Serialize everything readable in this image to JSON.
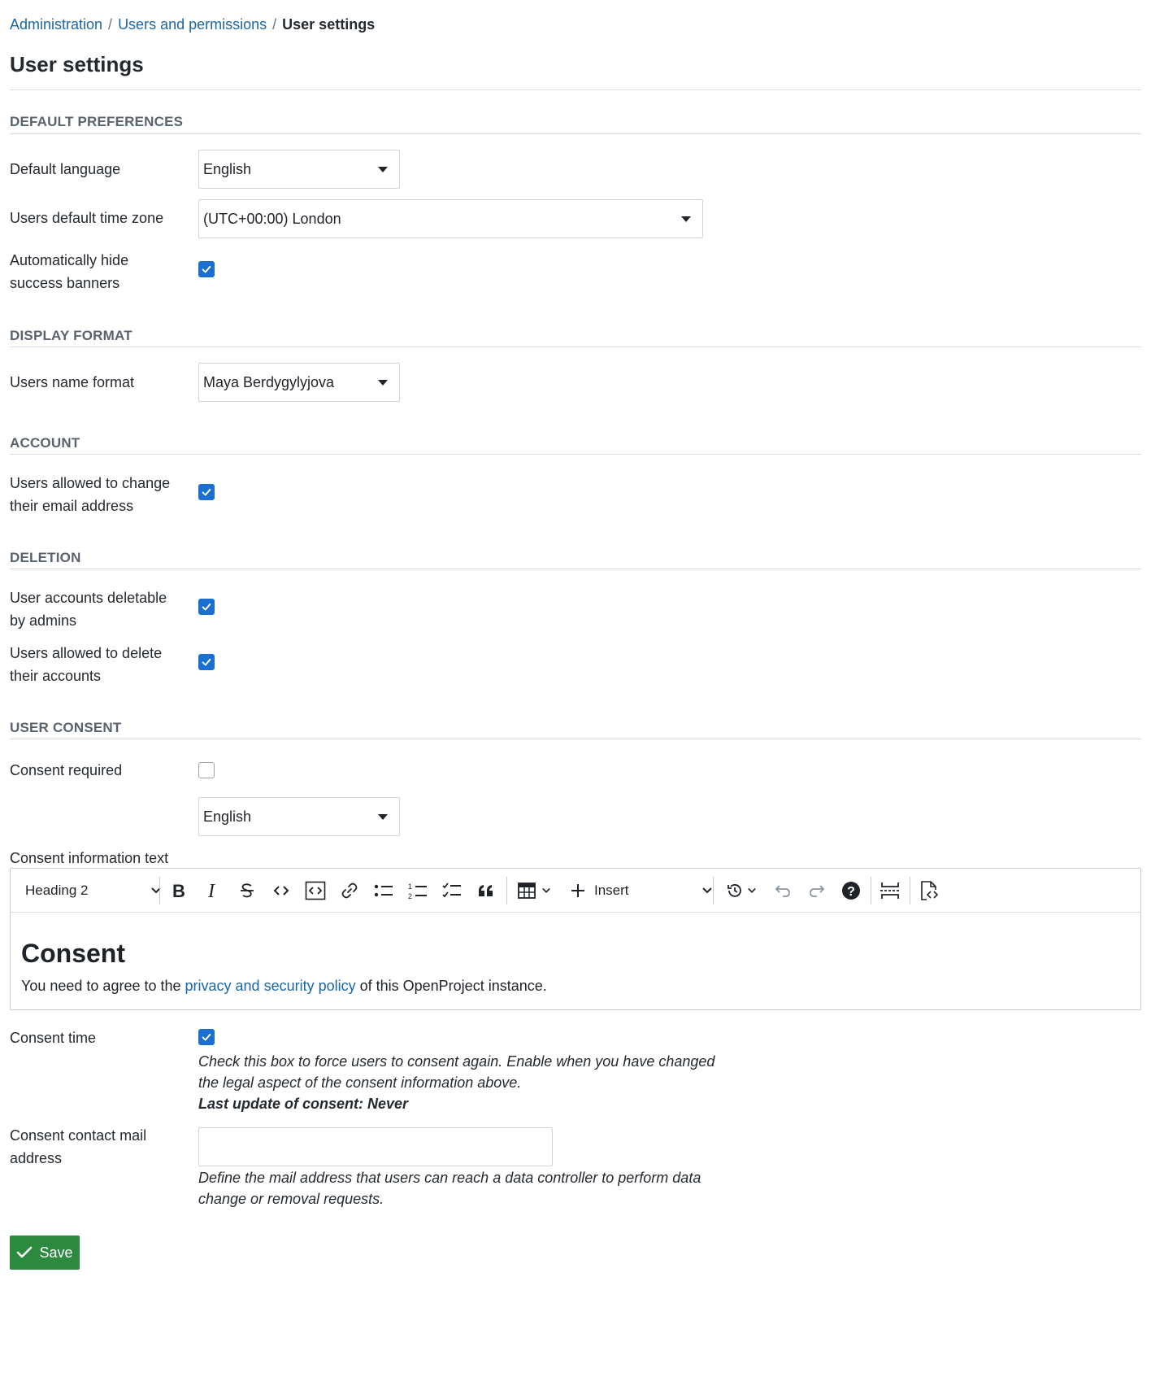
{
  "breadcrumb": {
    "items": [
      "Administration",
      "Users and permissions"
    ],
    "separator": "/",
    "current": "User settings"
  },
  "page_title": "User settings",
  "sections": {
    "default_preferences": {
      "title": "DEFAULT PREFERENCES",
      "default_language": {
        "label": "Default language",
        "value": "English"
      },
      "time_zone": {
        "label": "Users default time zone",
        "value": "(UTC+00:00) London"
      },
      "hide_banners": {
        "label": "Automatically hide success banners",
        "checked": true
      }
    },
    "display_format": {
      "title": "DISPLAY FORMAT",
      "name_format": {
        "label": "Users name format",
        "value": "Maya Berdygylyjova"
      }
    },
    "account": {
      "title": "ACCOUNT",
      "change_email": {
        "label": "Users allowed to change their email address",
        "checked": true
      }
    },
    "deletion": {
      "title": "DELETION",
      "deletable_by_admins": {
        "label": "User accounts deletable by admins",
        "checked": true
      },
      "users_delete_own": {
        "label": "Users allowed to delete their accounts",
        "checked": true
      }
    },
    "user_consent": {
      "title": "USER CONSENT",
      "consent_required": {
        "label": "Consent required",
        "checked": false
      },
      "consent_language": {
        "value": "English"
      },
      "consent_text": {
        "label": "Consent information text",
        "toolbar": {
          "heading_value": "Heading 2",
          "insert_label": "Insert",
          "icons": [
            "bold-icon",
            "italic-icon",
            "strikethrough-icon",
            "code-icon",
            "code-block-icon",
            "link-icon",
            "bulleted-list-icon",
            "numbered-list-icon",
            "todo-list-icon",
            "blockquote-icon",
            "table-icon",
            "plus-icon",
            "history-icon",
            "undo-icon",
            "redo-icon",
            "help-icon",
            "page-break-icon",
            "source-icon"
          ]
        },
        "heading": "Consent",
        "body_before": "You need to agree to the ",
        "body_link": "privacy and security policy",
        "body_after": " of this OpenProject instance."
      },
      "consent_time": {
        "label": "Consent time",
        "checked": true,
        "hint": "Check this box to force users to consent again. Enable when you have changed the legal aspect of the consent information above.",
        "last_update": "Last update of consent: Never"
      },
      "consent_mail": {
        "label": "Consent contact mail address",
        "value": "",
        "hint": "Define the mail address that users can reach a data controller to perform data change or removal requests."
      }
    }
  },
  "save_label": "Save",
  "colors": {
    "link": "#1a67a3",
    "checkbox_checked": "#1a6fd1",
    "save_button": "#2b8a3e",
    "section_title": "#5a636d"
  }
}
